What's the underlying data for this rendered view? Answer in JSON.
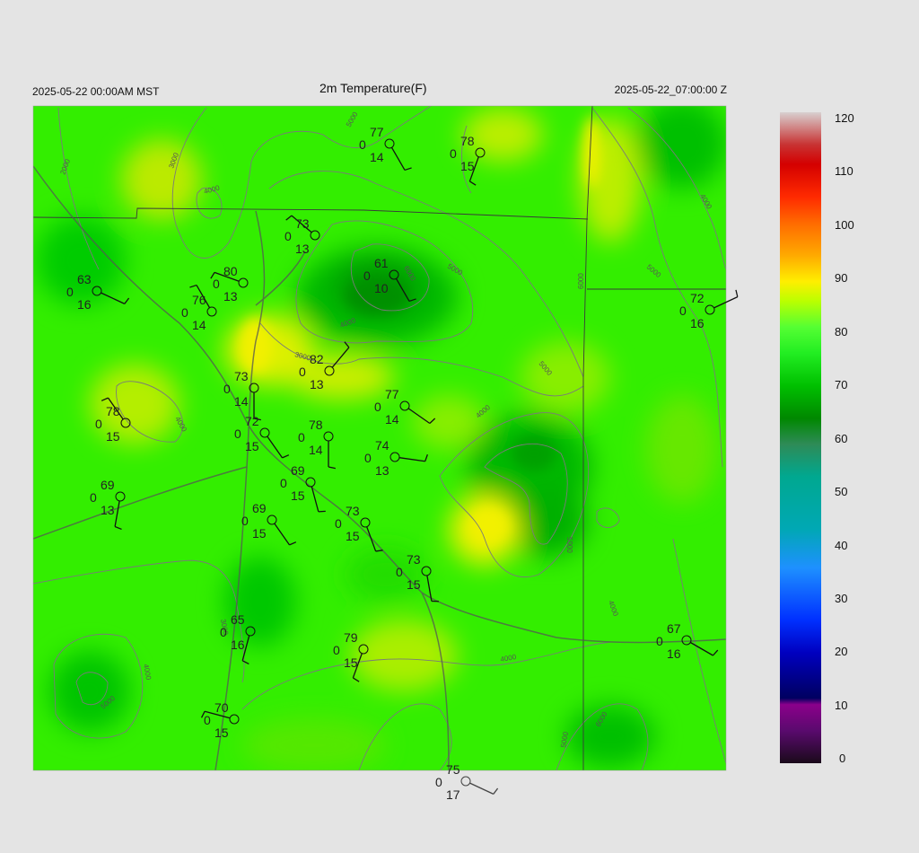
{
  "header": {
    "left": "2025-05-22 00:00AM MST",
    "title": "2m Temperature(F)",
    "right": "2025-05-22_07:00:00 Z"
  },
  "colorbar": {
    "labels": [
      "120",
      "110",
      "100",
      "90",
      "80",
      "70",
      "60",
      "50",
      "40",
      "30",
      "20",
      "10",
      "0"
    ],
    "range": [
      0,
      120
    ],
    "colors": [
      "#1a0a1a",
      "#5a0a6e",
      "#8b008b",
      "#000080",
      "#0000cd",
      "#1e90ff",
      "#00a0a0",
      "#2e8b57",
      "#00aa00",
      "#33ff33",
      "#bbff00",
      "#ffd400",
      "#ff8c00",
      "#ff2a00",
      "#d40000",
      "#d8c8c8"
    ]
  },
  "map": {
    "background": "#33ee00",
    "contour_labels": [
      "2000",
      "3000",
      "4000",
      "5000",
      "6000",
      "3000",
      "4000",
      "5000",
      "4000",
      "5000",
      "4000",
      "5000",
      "6000",
      "4000",
      "3000",
      "4000",
      "5000",
      "6000",
      "5000",
      "4000",
      "5000",
      "4000"
    ],
    "stations": [
      {
        "temp": "77",
        "dew": "0",
        "wind": "14"
      },
      {
        "temp": "78",
        "dew": "0",
        "wind": "15"
      },
      {
        "temp": "73",
        "dew": "0",
        "wind": "13"
      },
      {
        "temp": "63",
        "dew": "0",
        "wind": "16"
      },
      {
        "temp": "80",
        "dew": "0",
        "wind": "13"
      },
      {
        "temp": "76",
        "dew": "0",
        "wind": "14"
      },
      {
        "temp": "61",
        "dew": "0",
        "wind": "10"
      },
      {
        "temp": "72",
        "dew": "0",
        "wind": "16"
      },
      {
        "temp": "82",
        "dew": "0",
        "wind": "13"
      },
      {
        "temp": "73",
        "dew": "0",
        "wind": "14"
      },
      {
        "temp": "77",
        "dew": "0",
        "wind": "14"
      },
      {
        "temp": "78",
        "dew": "0",
        "wind": "15"
      },
      {
        "temp": "72",
        "dew": "0",
        "wind": "15"
      },
      {
        "temp": "78",
        "dew": "0",
        "wind": "14"
      },
      {
        "temp": "74",
        "dew": "0",
        "wind": "13"
      },
      {
        "temp": "69",
        "dew": "0",
        "wind": "15"
      },
      {
        "temp": "69",
        "dew": "0",
        "wind": "13"
      },
      {
        "temp": "69",
        "dew": "0",
        "wind": "15"
      },
      {
        "temp": "73",
        "dew": "0",
        "wind": "15"
      },
      {
        "temp": "73",
        "dew": "0",
        "wind": "15"
      },
      {
        "temp": "65",
        "dew": "0",
        "wind": "16"
      },
      {
        "temp": "67",
        "dew": "0",
        "wind": "16"
      },
      {
        "temp": "79",
        "dew": "0",
        "wind": "15"
      },
      {
        "temp": "70",
        "dew": "0",
        "wind": "15"
      },
      {
        "temp": "75",
        "dew": "0",
        "wind": "17"
      }
    ]
  }
}
